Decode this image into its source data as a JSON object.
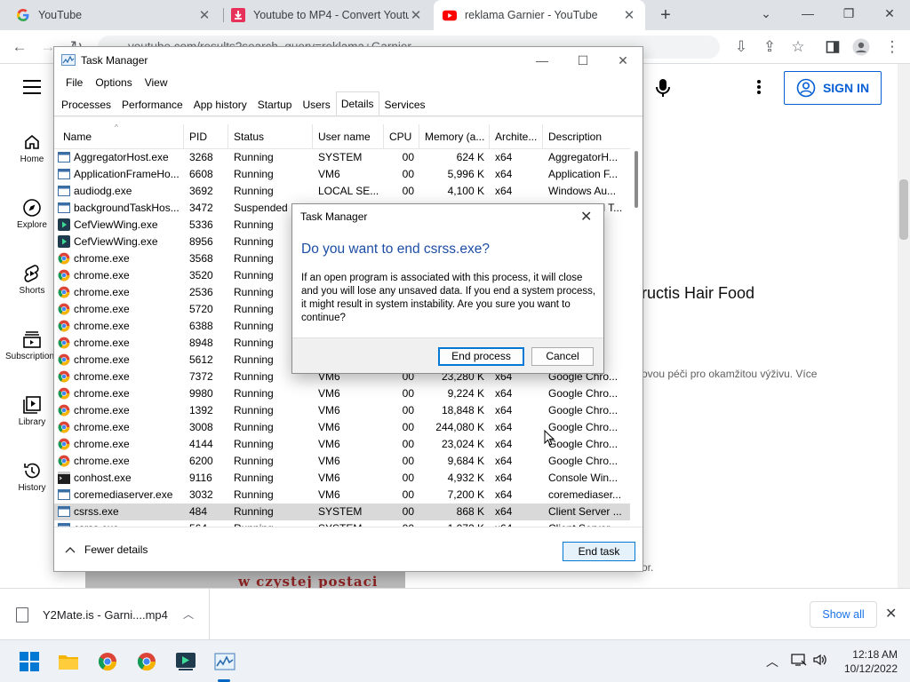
{
  "browser": {
    "tabs": [
      {
        "title": "YouTube",
        "icon": "google-g-icon",
        "active": false
      },
      {
        "title": "Youtube to MP4 - Convert Youtub",
        "icon": "download-arrow-icon",
        "active": false
      },
      {
        "title": "reklama Garnier - YouTube",
        "icon": "youtube-icon",
        "active": true
      }
    ],
    "url": "youtube.com/results?search_query=reklama+Garnier"
  },
  "youtube": {
    "sidebar": [
      {
        "label": "Home",
        "icon": "home-icon"
      },
      {
        "label": "Explore",
        "icon": "compass-icon"
      },
      {
        "label": "Shorts",
        "icon": "shorts-icon"
      },
      {
        "label": "Subscriptions",
        "icon": "subscriptions-icon"
      },
      {
        "label": "Library",
        "icon": "library-icon"
      },
      {
        "label": "History",
        "icon": "history-icon"
      }
    ],
    "sign_in": "SIGN IN",
    "video_title_fragment": "ructis Hair Food",
    "video_desc_fragment": "ovou péči pro okamžitou výživu. Více",
    "small_text_fragment": "or.",
    "thumbnail_text": "w czystej postaci"
  },
  "download_bar": {
    "file": "Y2Mate.is - Garni....mp4",
    "show_all": "Show all"
  },
  "taskbar": {
    "time": "12:18 AM",
    "date": "10/12/2022"
  },
  "task_manager": {
    "title": "Task Manager",
    "menu": [
      "File",
      "Options",
      "View"
    ],
    "tabs": [
      "Processes",
      "Performance",
      "App history",
      "Startup",
      "Users",
      "Details",
      "Services"
    ],
    "active_tab": "Details",
    "columns": [
      "Name",
      "PID",
      "Status",
      "User name",
      "CPU",
      "Memory (a...",
      "Archite...",
      "Description"
    ],
    "rows": [
      {
        "name": "AggregatorHost.exe",
        "pid": "3268",
        "status": "Running",
        "user": "SYSTEM",
        "cpu": "00",
        "mem": "624 K",
        "arch": "x64",
        "desc": "AggregatorH...",
        "icon": "app"
      },
      {
        "name": "ApplicationFrameHo...",
        "pid": "6608",
        "status": "Running",
        "user": "VM6",
        "cpu": "00",
        "mem": "5,996 K",
        "arch": "x64",
        "desc": "Application F...",
        "icon": "app"
      },
      {
        "name": "audiodg.exe",
        "pid": "3692",
        "status": "Running",
        "user": "LOCAL SE...",
        "cpu": "00",
        "mem": "4,100 K",
        "arch": "x64",
        "desc": "Windows Au...",
        "icon": "app"
      },
      {
        "name": "backgroundTaskHos...",
        "pid": "3472",
        "status": "Suspended",
        "user": "VM6",
        "cpu": "00",
        "mem": "0 K",
        "arch": "x64",
        "desc": "Background T...",
        "icon": "app"
      },
      {
        "name": "CefViewWing.exe",
        "pid": "5336",
        "status": "Running",
        "user": "",
        "cpu": "",
        "mem": "",
        "arch": "",
        "desc": "",
        "icon": "cef"
      },
      {
        "name": "CefViewWing.exe",
        "pid": "8956",
        "status": "Running",
        "user": "",
        "cpu": "",
        "mem": "",
        "arch": "",
        "desc": "",
        "icon": "cef"
      },
      {
        "name": "chrome.exe",
        "pid": "3568",
        "status": "Running",
        "user": "",
        "cpu": "",
        "mem": "",
        "arch": "",
        "desc": "...o...",
        "icon": "chrome"
      },
      {
        "name": "chrome.exe",
        "pid": "3520",
        "status": "Running",
        "user": "",
        "cpu": "",
        "mem": "",
        "arch": "",
        "desc": "...o...",
        "icon": "chrome"
      },
      {
        "name": "chrome.exe",
        "pid": "2536",
        "status": "Running",
        "user": "",
        "cpu": "",
        "mem": "",
        "arch": "",
        "desc": "...o...",
        "icon": "chrome"
      },
      {
        "name": "chrome.exe",
        "pid": "5720",
        "status": "Running",
        "user": "",
        "cpu": "",
        "mem": "",
        "arch": "",
        "desc": "...o...",
        "icon": "chrome"
      },
      {
        "name": "chrome.exe",
        "pid": "6388",
        "status": "Running",
        "user": "",
        "cpu": "",
        "mem": "",
        "arch": "",
        "desc": "...o...",
        "icon": "chrome"
      },
      {
        "name": "chrome.exe",
        "pid": "8948",
        "status": "Running",
        "user": "",
        "cpu": "",
        "mem": "",
        "arch": "",
        "desc": "...o...",
        "icon": "chrome"
      },
      {
        "name": "chrome.exe",
        "pid": "5612",
        "status": "Running",
        "user": "",
        "cpu": "",
        "mem": "",
        "arch": "",
        "desc": "...o...",
        "icon": "chrome"
      },
      {
        "name": "chrome.exe",
        "pid": "7372",
        "status": "Running",
        "user": "VM6",
        "cpu": "00",
        "mem": "23,280 K",
        "arch": "x64",
        "desc": "Google Chro...",
        "icon": "chrome"
      },
      {
        "name": "chrome.exe",
        "pid": "9980",
        "status": "Running",
        "user": "VM6",
        "cpu": "00",
        "mem": "9,224 K",
        "arch": "x64",
        "desc": "Google Chro...",
        "icon": "chrome"
      },
      {
        "name": "chrome.exe",
        "pid": "1392",
        "status": "Running",
        "user": "VM6",
        "cpu": "00",
        "mem": "18,848 K",
        "arch": "x64",
        "desc": "Google Chro...",
        "icon": "chrome"
      },
      {
        "name": "chrome.exe",
        "pid": "3008",
        "status": "Running",
        "user": "VM6",
        "cpu": "00",
        "mem": "244,080 K",
        "arch": "x64",
        "desc": "Google Chro...",
        "icon": "chrome"
      },
      {
        "name": "chrome.exe",
        "pid": "4144",
        "status": "Running",
        "user": "VM6",
        "cpu": "00",
        "mem": "23,024 K",
        "arch": "x64",
        "desc": "Google Chro...",
        "icon": "chrome"
      },
      {
        "name": "chrome.exe",
        "pid": "6200",
        "status": "Running",
        "user": "VM6",
        "cpu": "00",
        "mem": "9,684 K",
        "arch": "x64",
        "desc": "Google Chro...",
        "icon": "chrome"
      },
      {
        "name": "conhost.exe",
        "pid": "9116",
        "status": "Running",
        "user": "VM6",
        "cpu": "00",
        "mem": "4,932 K",
        "arch": "x64",
        "desc": "Console Win...",
        "icon": "console"
      },
      {
        "name": "coremediaserver.exe",
        "pid": "3032",
        "status": "Running",
        "user": "VM6",
        "cpu": "00",
        "mem": "7,200 K",
        "arch": "x64",
        "desc": "coremediaser...",
        "icon": "app"
      },
      {
        "name": "csrss.exe",
        "pid": "484",
        "status": "Running",
        "user": "SYSTEM",
        "cpu": "00",
        "mem": "868 K",
        "arch": "x64",
        "desc": "Client Server ...",
        "icon": "app",
        "selected": true
      },
      {
        "name": "csrss.exe",
        "pid": "564",
        "status": "Running",
        "user": "SYSTEM",
        "cpu": "00",
        "mem": "1,072 K",
        "arch": "x64",
        "desc": "Client Server ...",
        "icon": "app"
      }
    ],
    "fewer_details": "Fewer details",
    "end_task": "End task"
  },
  "dialog": {
    "title": "Task Manager",
    "heading": "Do you want to end csrss.exe?",
    "body": "If an open program is associated with this process, it will close and you will lose any unsaved data. If you end a system process, it might result in system instability. Are you sure you want to continue?",
    "end_process": "End process",
    "cancel": "Cancel"
  }
}
